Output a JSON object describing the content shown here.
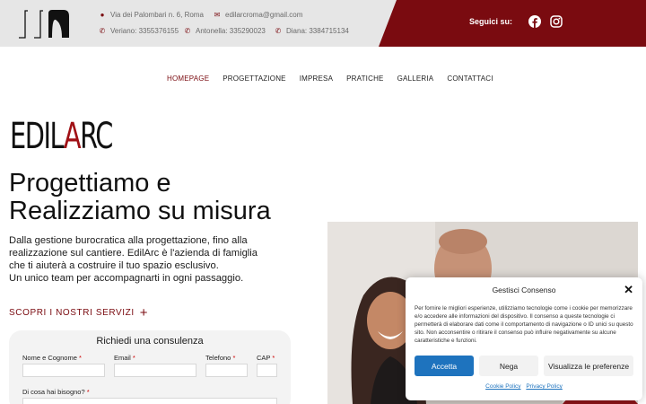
{
  "header": {
    "address": "Via dei Palombari n. 6, Roma",
    "email": "edilarcroma@gmail.com",
    "phones": [
      {
        "text": "Veriano: 3355376155"
      },
      {
        "text": "Antonella: 335290023"
      },
      {
        "text": "Diana: 3384715134"
      }
    ],
    "social_label": "Seguici su:",
    "social_icons": [
      "facebook-icon",
      "instagram-icon"
    ]
  },
  "nav": {
    "items": [
      {
        "label": "HOMEPAGE",
        "active": true
      },
      {
        "label": "PROGETTAZIONE"
      },
      {
        "label": "IMPRESA"
      },
      {
        "label": "PRATICHE"
      },
      {
        "label": "GALLERIA"
      },
      {
        "label": "CONTATTACI"
      }
    ]
  },
  "hero": {
    "brand_pre": "EDIL",
    "brand_accent": "A",
    "brand_post": "RC",
    "headline_line1": "Progettiamo e",
    "headline_line2": "Realizziamo su misura",
    "intro_line1": "Dalla gestione burocratica alla progettazione, fino alla",
    "intro_line2": "realizzazione sul cantiere. EdilArc è l'azienda di famiglia",
    "intro_line3": "che ti aiuterà a costruire il tuo spazio esclusivo.",
    "intro_line4": "Un unico team per accompagnarti in ogni passaggio.",
    "cta": "SCOPRI I NOSTRI SERVIZI"
  },
  "form": {
    "title": "Richiedi una consulenza",
    "fields": {
      "name": "Nome e Cognome",
      "email": "Email",
      "phone": "Telefono",
      "cap": "CAP",
      "need": "Di cosa hai bisogno?"
    },
    "required_mark": "*"
  },
  "cookie": {
    "title": "Gestisci Consenso",
    "text": "Per fornire le migliori esperienze, utilizziamo tecnologie come i cookie per memorizzare e/o accedere alle informazioni del dispositivo. Il consenso a queste tecnologie ci permetterà di elaborare dati come il comportamento di navigazione o ID unici su questo sito. Non acconsentire o ritirare il consenso può influire negativamente su alcune caratteristiche e funzioni.",
    "accept": "Accetta",
    "deny": "Nega",
    "preferences": "Visualizza le preferenze",
    "cookie_policy": "Cookie Policy",
    "privacy_policy": "Privacy Policy"
  },
  "colors": {
    "brand_red": "#7a0b10",
    "accept_blue": "#1e73be"
  }
}
